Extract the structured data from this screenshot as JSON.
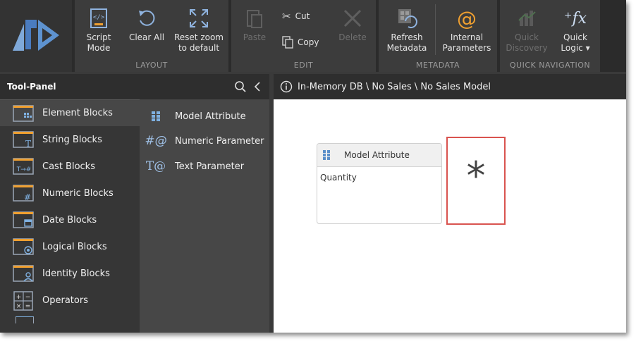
{
  "ribbon": {
    "layout": {
      "group_label": "LAYOUT",
      "script_mode": "Script\nMode",
      "clear_all": "Clear All",
      "reset_zoom": "Reset zoom\nto default"
    },
    "edit": {
      "group_label": "EDIT",
      "paste": "Paste",
      "cut": "Cut",
      "copy": "Copy",
      "delete": "Delete"
    },
    "metadata": {
      "group_label": "METADATA",
      "refresh": "Refresh\nMetadata",
      "internal_params": "Internal\nParameters"
    },
    "quick_nav": {
      "group_label": "QUICK NAVIGATION",
      "quick_discovery": "Quick\nDiscovery",
      "quick_logic": "Quick\nLogic ▾"
    }
  },
  "tool_panel": {
    "title": "Tool-Panel",
    "categories": [
      {
        "label": "Element Blocks"
      },
      {
        "label": "String Blocks"
      },
      {
        "label": "Cast Blocks"
      },
      {
        "label": "Numeric Blocks"
      },
      {
        "label": "Date Blocks"
      },
      {
        "label": "Logical Blocks"
      },
      {
        "label": "Identity Blocks"
      },
      {
        "label": "Operators"
      }
    ],
    "blocks": [
      {
        "label": "Model Attribute"
      },
      {
        "label": "Numeric Parameter"
      },
      {
        "label": "Text Parameter"
      }
    ]
  },
  "canvas": {
    "breadcrumb": "In-Memory DB \\ No Sales \\ No Sales Model",
    "attribute_block": {
      "title": "Model Attribute",
      "value": "Quantity"
    },
    "operator_symbol": "*"
  },
  "colors": {
    "accent_orange": "#f0a030",
    "highlight_red": "#d9534f",
    "icon_blue": "#7fb0e0"
  }
}
